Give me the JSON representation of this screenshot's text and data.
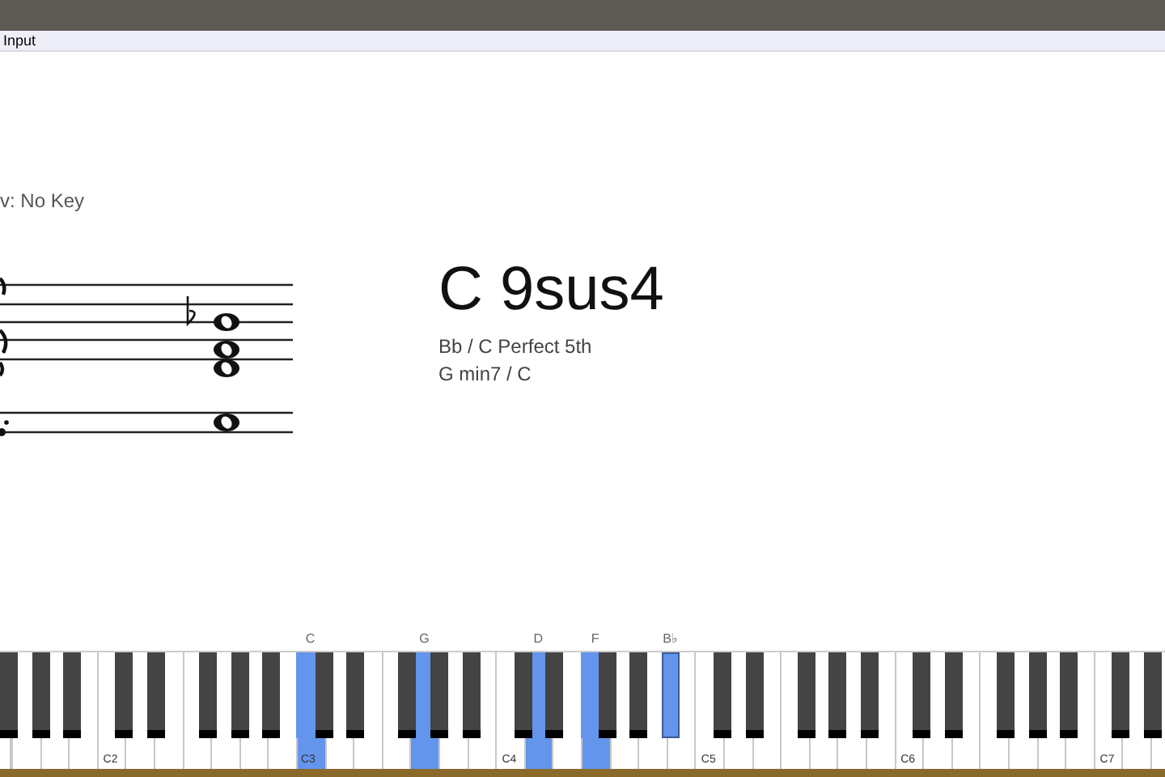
{
  "tab": {
    "label": "Input"
  },
  "key_label": "v: No Key",
  "chord": {
    "name": "C 9sus4",
    "alternatives": [
      "Bb / C Perfect 5th",
      "G min7 / C"
    ]
  },
  "keyboard": {
    "octave_labels": [
      "C2",
      "C3",
      "C4",
      "C5",
      "C6",
      "C7"
    ],
    "white_keys": [
      {
        "selected": false
      },
      {
        "selected": false
      },
      {
        "selected": false
      },
      {
        "selected": false
      },
      {
        "selected": false
      },
      {
        "selected": false
      },
      {
        "selected": false
      },
      {
        "selected": false
      },
      {
        "selected": false
      },
      {
        "selected": false
      },
      {
        "selected": false
      },
      {
        "selected": true,
        "label": "C"
      },
      {
        "selected": false
      },
      {
        "selected": false
      },
      {
        "selected": false
      },
      {
        "selected": true,
        "label": "G"
      },
      {
        "selected": false
      },
      {
        "selected": false
      },
      {
        "selected": false
      },
      {
        "selected": true,
        "label": "D"
      },
      {
        "selected": false
      },
      {
        "selected": true,
        "label": "F"
      },
      {
        "selected": false
      },
      {
        "selected": false
      },
      {
        "selected": false
      },
      {
        "selected": false
      },
      {
        "selected": false
      },
      {
        "selected": false
      },
      {
        "selected": false
      },
      {
        "selected": false
      },
      {
        "selected": false
      },
      {
        "selected": false
      },
      {
        "selected": false
      },
      {
        "selected": false
      },
      {
        "selected": false
      },
      {
        "selected": false
      },
      {
        "selected": false
      },
      {
        "selected": false
      },
      {
        "selected": false
      },
      {
        "selected": false
      },
      {
        "selected": false
      },
      {
        "selected": false
      }
    ],
    "black_keys": [
      {
        "selected": false
      },
      {
        "selected": false
      },
      {
        "selected": false
      },
      {
        "selected": false
      },
      {
        "selected": false
      },
      {
        "selected": false
      },
      {
        "selected": false
      },
      {
        "selected": false
      },
      {
        "selected": false
      },
      {
        "selected": false
      },
      {
        "selected": false
      },
      {
        "selected": false
      },
      {
        "selected": false
      },
      {
        "selected": false
      },
      {
        "selected": false
      },
      {
        "selected": false
      },
      {
        "selected": false
      },
      {
        "selected": true,
        "label": "B♭"
      },
      {
        "selected": false
      },
      {
        "selected": false
      },
      {
        "selected": false
      },
      {
        "selected": false
      },
      {
        "selected": false
      },
      {
        "selected": false
      },
      {
        "selected": false
      },
      {
        "selected": false
      },
      {
        "selected": false
      },
      {
        "selected": false
      },
      {
        "selected": false
      },
      {
        "selected": false
      }
    ]
  }
}
